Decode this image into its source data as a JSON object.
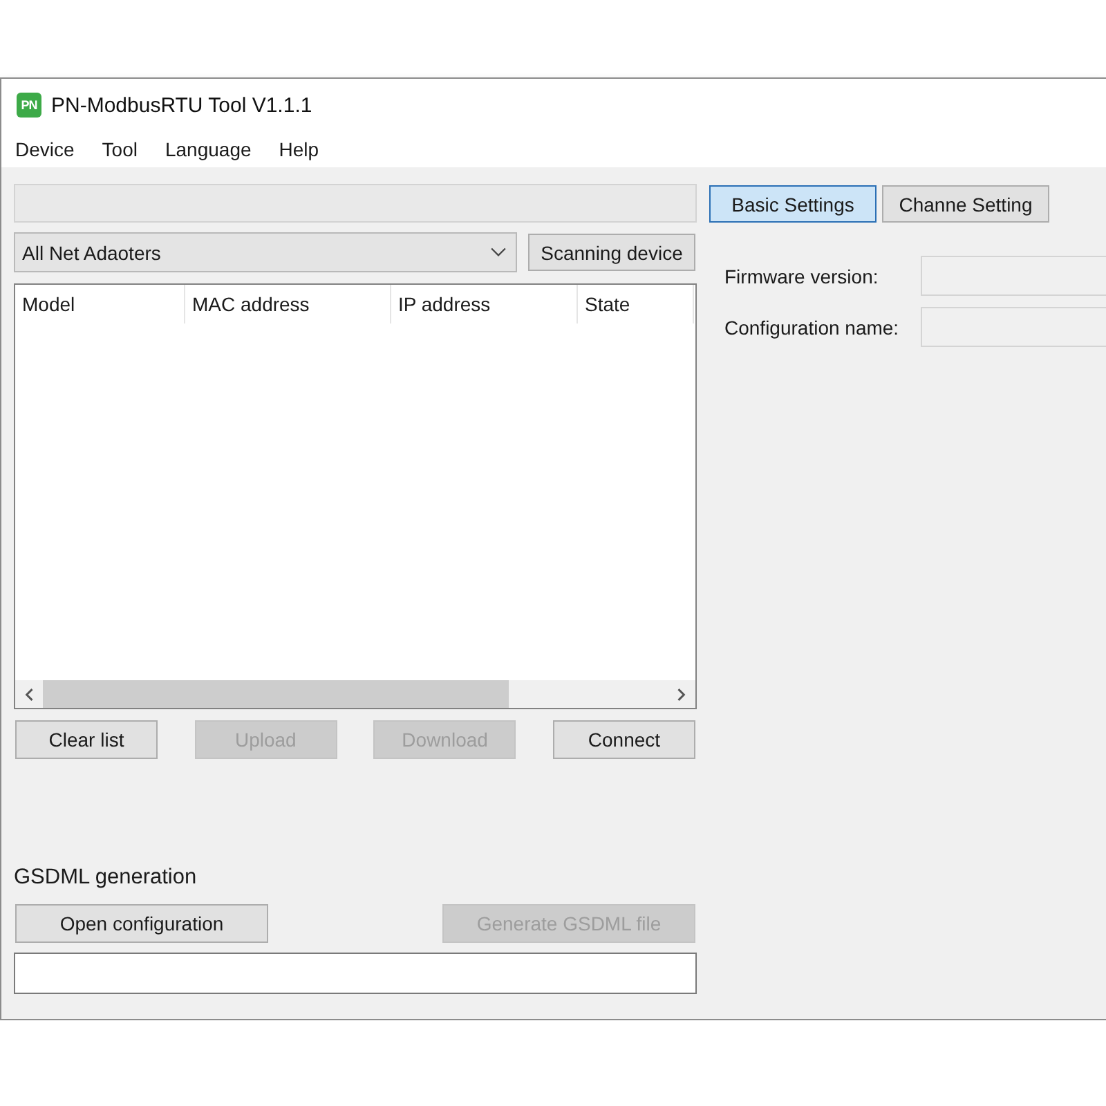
{
  "window": {
    "icon_text": "PN",
    "title": "PN-ModbusRTU Tool V1.1.1"
  },
  "menu": [
    "Device",
    "Tool",
    "Language",
    "Help"
  ],
  "device_panel": {
    "adapter_select": {
      "value": "All Net Adaoters"
    },
    "scan_button": {
      "label": "Scanning device",
      "disabled": false
    },
    "table": {
      "columns": [
        "Model",
        "MAC address",
        "IP address",
        "State"
      ]
    },
    "buttons": [
      {
        "label": "Clear list",
        "disabled": false
      },
      {
        "label": "Upload",
        "disabled": true
      },
      {
        "label": "Download",
        "disabled": true
      },
      {
        "label": "Connect",
        "disabled": false
      }
    ]
  },
  "gsdml": {
    "heading": "GSDML generation",
    "buttons": [
      {
        "label": "Open configuration",
        "disabled": false
      },
      {
        "label": "Generate GSDML file",
        "disabled": true
      }
    ]
  },
  "tabs": [
    {
      "label": "Basic Settings",
      "selected": true
    },
    {
      "label": "Channe Setting",
      "selected": false
    }
  ],
  "fields": [
    {
      "label": "Firmware version:"
    },
    {
      "label": "Configuration name:"
    }
  ]
}
